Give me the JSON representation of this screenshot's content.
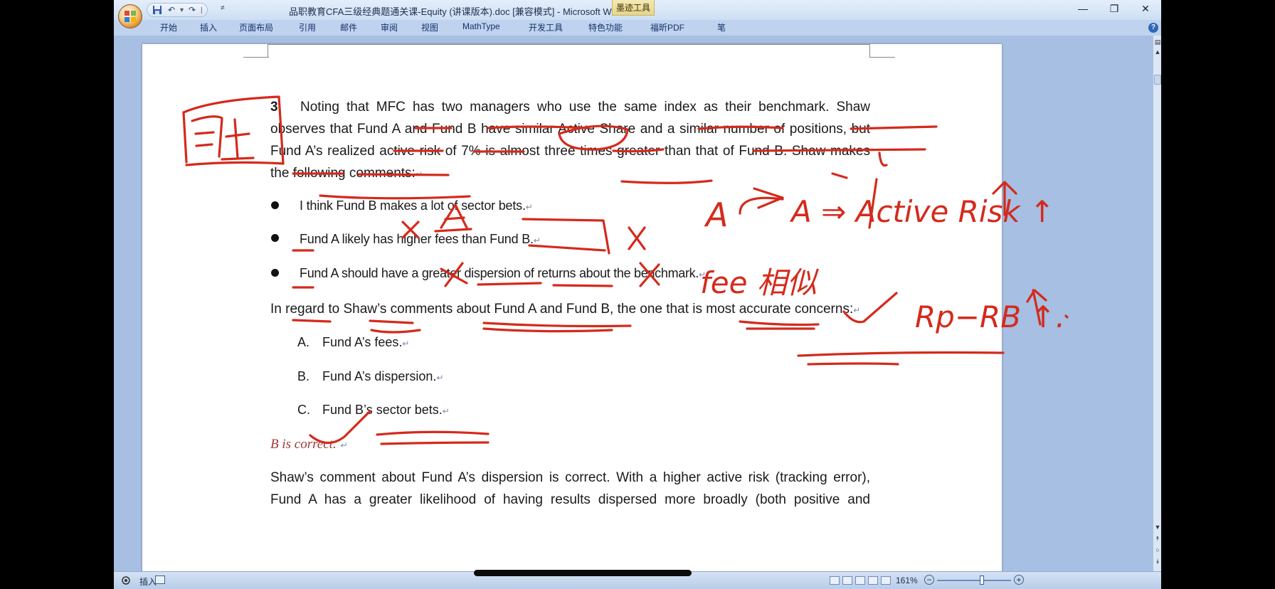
{
  "window": {
    "title": "品职教育CFA三级经典题通关课-Equity (讲课版本).doc [兼容模式] - Microsoft Word",
    "contextual_tab": "墨迹工具",
    "minimize": "—",
    "restore": "❐",
    "close": "✕"
  },
  "qat": {
    "undo": "↶",
    "redo": "↷",
    "separator": "|",
    "more": "≠"
  },
  "ribbon": {
    "tabs": [
      "开始",
      "插入",
      "页面布局",
      "引用",
      "邮件",
      "审阅",
      "视图",
      "MathType",
      "开发工具",
      "特色功能",
      "福昕PDF",
      "笔"
    ],
    "help": "?"
  },
  "document": {
    "q_number": "3.",
    "q_line1": "Noting that MFC has two managers who use the same index as their benchmark. Shaw",
    "q_line2": "observes that Fund A and Fund B have similar Active Share and a similar number of positions, but",
    "q_line3": "Fund A’s realized active risk of 7% is almost three times greater than that of Fund B. Shaw makes",
    "q_line4": "the following comments:",
    "bullets": [
      "I think Fund B makes a lot of sector bets.",
      "Fund A likely has higher fees than Fund B.",
      "Fund A should have a greater dispersion of returns about the benchmark."
    ],
    "prompt": "In regard to Shaw’s comments about Fund A and Fund B, the one that is most accurate concerns:",
    "options": [
      {
        "letter": "A.",
        "text": "Fund A’s fees."
      },
      {
        "letter": "B.",
        "text": "Fund A’s dispersion."
      },
      {
        "letter": "C.",
        "text": "Fund B’s sector bets."
      }
    ],
    "answer": "B is correct.",
    "explanation_line1": "Shaw’s comment about Fund A’s dispersion is correct. With a higher active risk (tracking error),",
    "explanation_line2": "Fund A has a greater likelihood of having results dispersed more broadly (both positive and",
    "para_mark": "↵"
  },
  "annotations": {
    "margin_note": "同上",
    "fund_letter": "A",
    "risk_note": "A ⇒ Active Risk ↑",
    "fee_note": "fee 相似",
    "dispersion_note": "Rp−RB ↑."
  },
  "statusbar": {
    "insert_label": "插入",
    "zoom": "161%",
    "zoom_fraction": 0.61,
    "zoom_out": "−",
    "zoom_in": "+"
  },
  "colors": {
    "ink": "#d42a1c",
    "ribbon": "#bfd3ee",
    "workspace": "#a6bfe2"
  }
}
